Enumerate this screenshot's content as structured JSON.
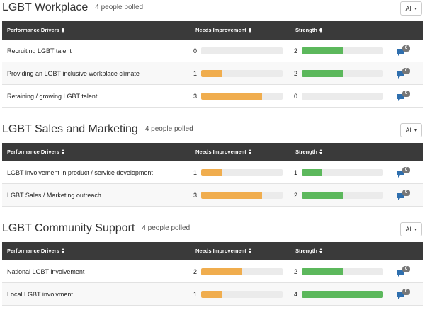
{
  "colors": {
    "header_bg": "#3a3a3a",
    "needs": "#f0ad4e",
    "strength": "#5cb85c",
    "track": "#ebebeb",
    "comment": "#2f6fae"
  },
  "icons": {
    "sort": "sort-icon",
    "comment": "comment-icon",
    "dropdown": "caret-down-icon"
  },
  "sections": [
    {
      "title": "LGBT Workplace",
      "polled": "4 people polled",
      "filter_label": "All",
      "headers": {
        "drivers": "Performance Drivers",
        "needs": "Needs Improvement",
        "strength": "Strength"
      },
      "rows": [
        {
          "label": "Recruiting LGBT talent",
          "needs": 0,
          "strength": 2,
          "comments": "0"
        },
        {
          "label": "Providing an LGBT inclusive workplace climate",
          "needs": 1,
          "strength": 2,
          "comments": "0"
        },
        {
          "label": "Retaining / growing LGBT talent",
          "needs": 3,
          "strength": 0,
          "comments": "0"
        }
      ]
    },
    {
      "title": "LGBT Sales and Marketing",
      "polled": "4 people polled",
      "filter_label": "All",
      "headers": {
        "drivers": "Performance Drivers",
        "needs": "Needs Improvement",
        "strength": "Strength"
      },
      "rows": [
        {
          "label": "LGBT involvement in product / service development",
          "needs": 1,
          "strength": 1,
          "comments": "0"
        },
        {
          "label": "LGBT Sales / Marketing outreach",
          "needs": 3,
          "strength": 2,
          "comments": "0"
        }
      ]
    },
    {
      "title": "LGBT Community Support",
      "polled": "4 people polled",
      "filter_label": "All",
      "headers": {
        "drivers": "Performance Drivers",
        "needs": "Needs Improvement",
        "strength": "Strength"
      },
      "rows": [
        {
          "label": "National LGBT involvement",
          "needs": 2,
          "strength": 2,
          "comments": "0"
        },
        {
          "label": "Local LGBT involvment",
          "needs": 1,
          "strength": 4,
          "comments": "0"
        }
      ]
    }
  ],
  "scale_max": 4
}
